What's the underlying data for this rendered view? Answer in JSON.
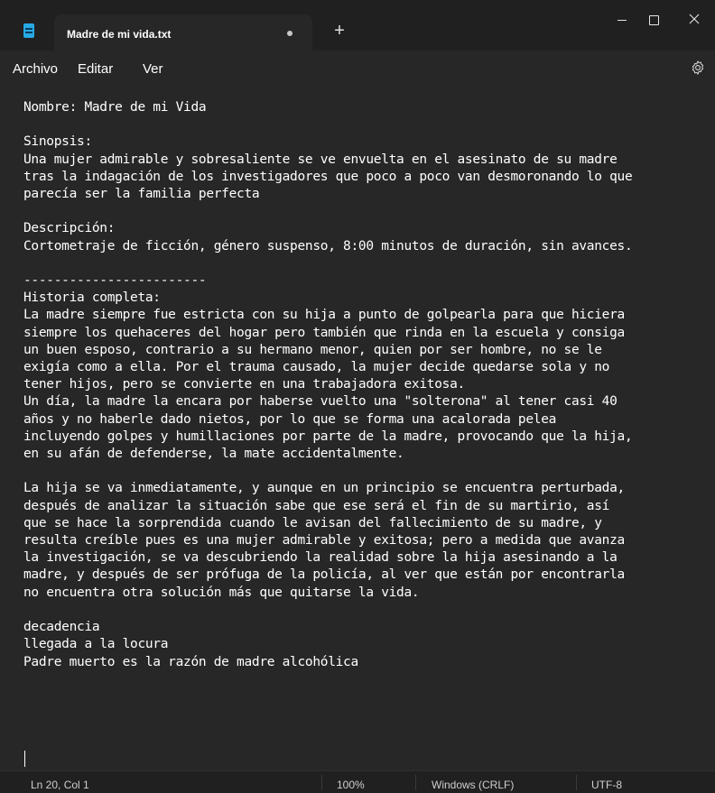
{
  "window": {
    "tab_title": "Madre de mi vida.txt",
    "new_tab_glyph": "+",
    "app_icon": "notepad-icon",
    "unsaved_indicator": "dot"
  },
  "menu": {
    "items": [
      "Archivo",
      "Editar",
      "Ver"
    ],
    "settings_icon": "gear-icon"
  },
  "editor": {
    "lines": [
      "Nombre: Madre de mi Vida",
      "",
      "Sinopsis:",
      "Una mujer admirable y sobresaliente se ve envuelta en el asesinato de su madre",
      "tras la indagación de los investigadores que poco a poco van desmoronando lo que",
      "parecía ser la familia perfecta",
      "",
      "Descripción:",
      "Cortometraje de ficción, género suspenso, 8:00 minutos de duración, sin avances.",
      "",
      "------------------------",
      "Historia completa:",
      "La madre siempre fue estricta con su hija a punto de golpearla para que hiciera",
      "siempre los quehaceres del hogar pero también que rinda en la escuela y consiga",
      "un buen esposo, contrario a su hermano menor, quien por ser hombre, no se le",
      "exigía como a ella. Por el trauma causado, la mujer decide quedarse sola y no",
      "tener hijos, pero se convierte en una trabajadora exitosa.",
      "Un día, la madre la encara por haberse vuelto una \"solterona\" al tener casi 40",
      "años y no haberle dado nietos, por lo que se forma una acalorada pelea",
      "incluyendo golpes y humillaciones por parte de la madre, provocando que la hija,",
      "en su afán de defenderse, la mate accidentalmente.",
      "",
      "La hija se va inmediatamente, y aunque en un principio se encuentra perturbada,",
      "después de analizar la situación sabe que ese será el fin de su martirio, así",
      "que se hace la sorprendida cuando le avisan del fallecimiento de su madre, y",
      "resulta creíble pues es una mujer admirable y exitosa; pero a medida que avanza",
      "la investigación, se va descubriendo la realidad sobre la hija asesinando a la",
      "madre, y después de ser prófuga de la policía, al ver que están por encontrarla",
      "no encuentra otra solución más que quitarse la vida.",
      "",
      "decadencia",
      "llegada a la locura",
      "Padre muerto es la razón de madre alcohólica",
      "",
      ""
    ]
  },
  "status": {
    "position": "Ln 20, Col 1",
    "zoom": "100%",
    "line_endings": "Windows (CRLF)",
    "encoding": "UTF-8"
  },
  "colors": {
    "background": "#272727",
    "titlebar": "#202020",
    "text": "#ffffff",
    "accent_icon": "#27a9e6"
  }
}
